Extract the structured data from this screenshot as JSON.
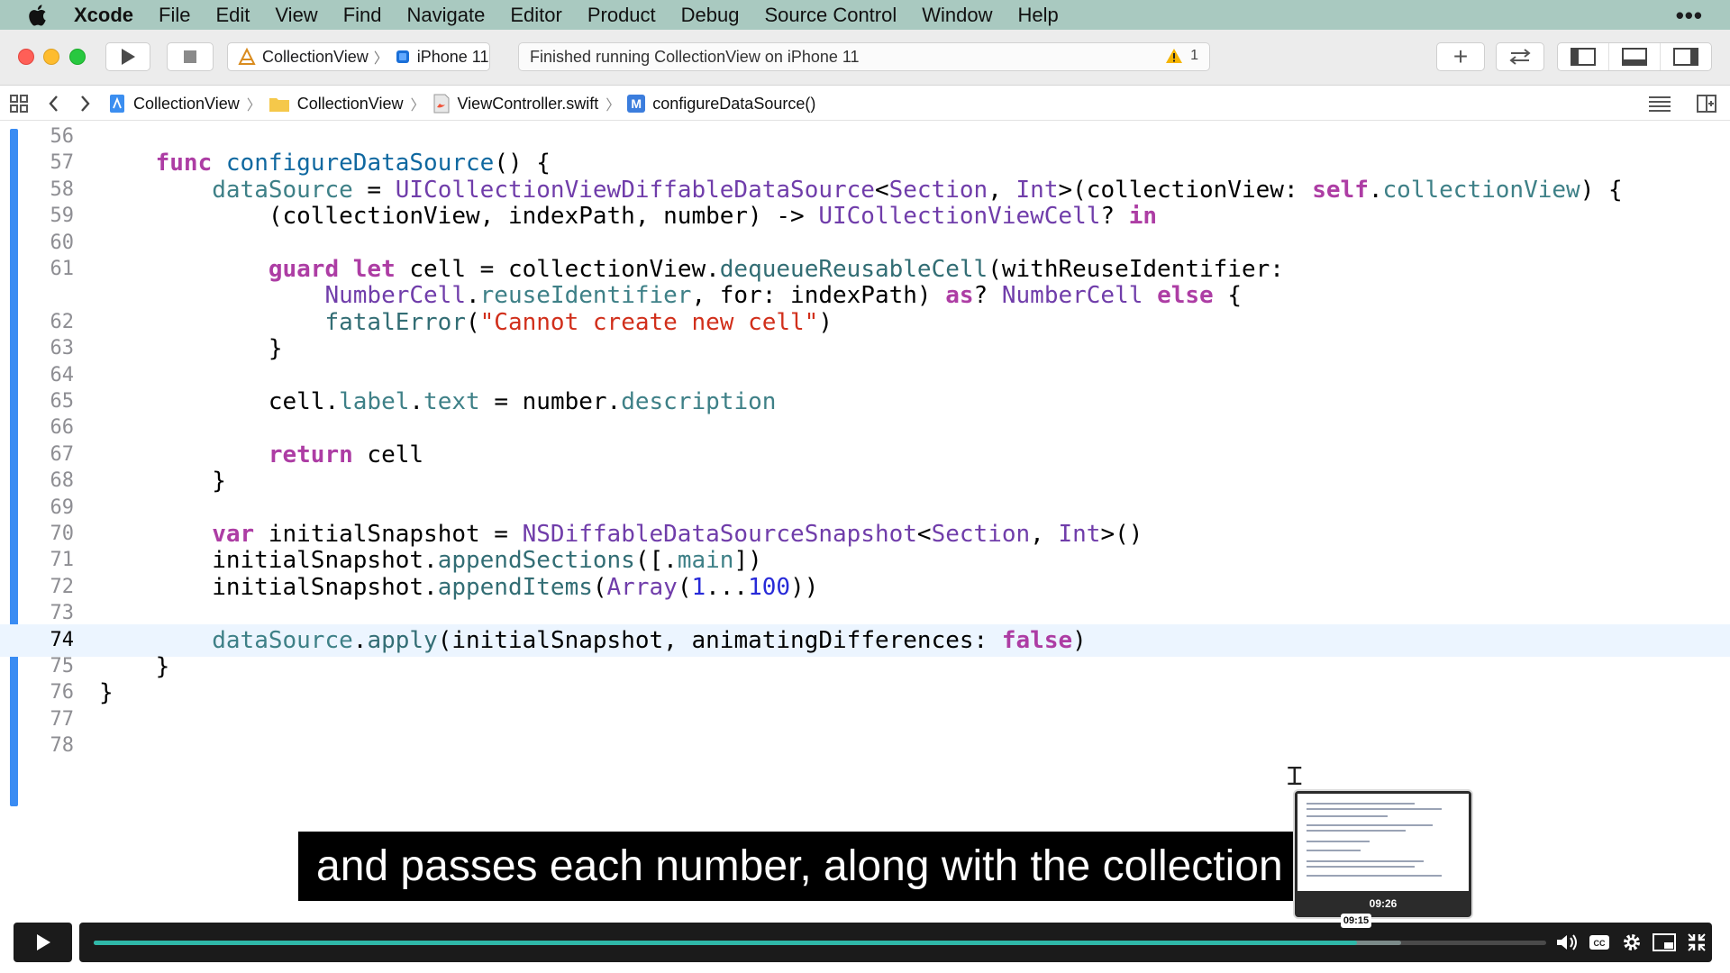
{
  "menubar": {
    "app_name": "Xcode",
    "items": [
      "File",
      "Edit",
      "View",
      "Find",
      "Navigate",
      "Editor",
      "Product",
      "Debug",
      "Source Control",
      "Window",
      "Help"
    ],
    "overflow": "•••"
  },
  "toolbar": {
    "scheme": "CollectionView",
    "device": "iPhone 11",
    "activity_status": "Finished running CollectionView on iPhone 11",
    "warning_count": "1",
    "add_label": "+"
  },
  "jumpbar": {
    "crumbs": [
      "CollectionView",
      "CollectionView",
      "ViewController.swift",
      "configureDataSource()"
    ],
    "method_badge": "M"
  },
  "editor": {
    "current_line": 74,
    "code": [
      {
        "ln": "56",
        "src": ""
      },
      {
        "ln": "57",
        "src": "    func configureDataSource() {"
      },
      {
        "ln": "58",
        "src": "        dataSource = UICollectionViewDiffableDataSource<Section, Int>(collectionView: self.collectionView) {"
      },
      {
        "ln": "59",
        "src": "            (collectionView, indexPath, number) -> UICollectionViewCell? in"
      },
      {
        "ln": "60",
        "src": ""
      },
      {
        "ln": "61",
        "src": "            guard let cell = collectionView.dequeueReusableCell(withReuseIdentifier:"
      },
      {
        "ln": "",
        "src": "                NumberCell.reuseIdentifier, for: indexPath) as? NumberCell else {"
      },
      {
        "ln": "62",
        "src": "                fatalError(\"Cannot create new cell\")"
      },
      {
        "ln": "63",
        "src": "            }"
      },
      {
        "ln": "64",
        "src": ""
      },
      {
        "ln": "65",
        "src": "            cell.label.text = number.description"
      },
      {
        "ln": "66",
        "src": ""
      },
      {
        "ln": "67",
        "src": "            return cell"
      },
      {
        "ln": "68",
        "src": "        }"
      },
      {
        "ln": "69",
        "src": ""
      },
      {
        "ln": "70",
        "src": "        var initialSnapshot = NSDiffableDataSourceSnapshot<Section, Int>()"
      },
      {
        "ln": "71",
        "src": "        initialSnapshot.appendSections([.main])"
      },
      {
        "ln": "72",
        "src": "        initialSnapshot.appendItems(Array(1...100))"
      },
      {
        "ln": "73",
        "src": ""
      },
      {
        "ln": "74",
        "src": "        dataSource.apply(initialSnapshot, animatingDifferences: false)"
      },
      {
        "ln": "75",
        "src": "    }"
      },
      {
        "ln": "76",
        "src": "}"
      },
      {
        "ln": "77",
        "src": ""
      },
      {
        "ln": "78",
        "src": ""
      }
    ]
  },
  "video": {
    "caption": "and passes each number, along with the collection",
    "thumbnail_time": "09:26",
    "hover_time": "09:15",
    "played_fraction": 0.87,
    "buffered_fraction": 0.9
  },
  "colors": {
    "keyword": "#ad3da4",
    "type": "#703daa",
    "function": "#326d74",
    "property": "#3e8087",
    "string": "#d12f1b",
    "number": "#272ad8",
    "progress": "#2fb8a8",
    "menubar": "#a9c9c0"
  }
}
